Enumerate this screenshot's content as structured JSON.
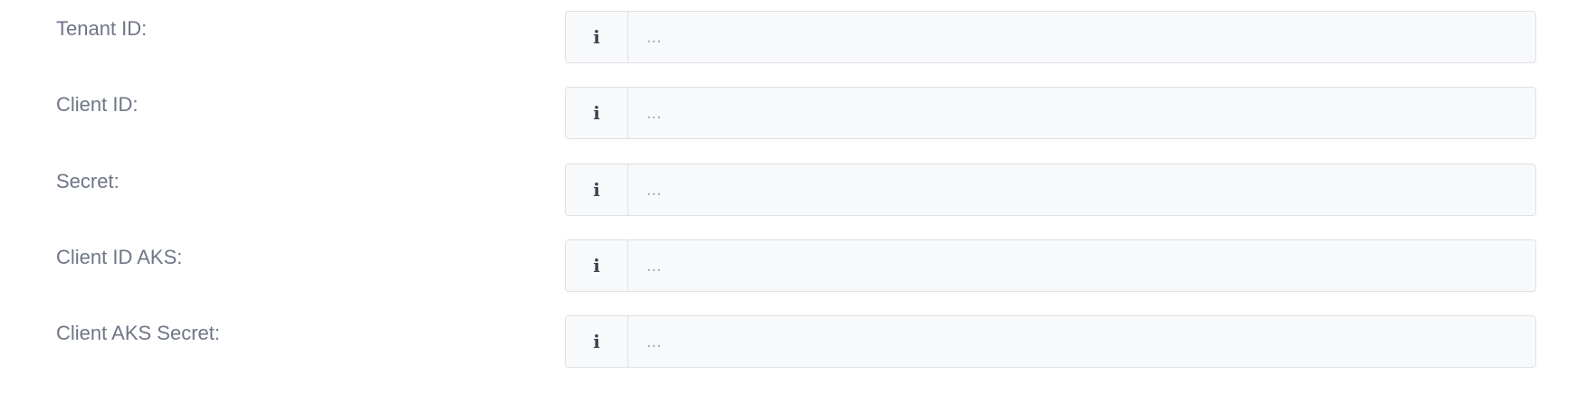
{
  "form": {
    "fields": [
      {
        "label": "Tenant ID:",
        "value": "",
        "placeholder": "...",
        "icon": "info-icon",
        "icon_glyph": "i"
      },
      {
        "label": "Client ID:",
        "value": "",
        "placeholder": "...",
        "icon": "info-icon",
        "icon_glyph": "i"
      },
      {
        "label": "Secret:",
        "value": "",
        "placeholder": "...",
        "icon": "info-icon",
        "icon_glyph": "i"
      },
      {
        "label": "Client ID AKS:",
        "value": "",
        "placeholder": "...",
        "icon": "info-icon",
        "icon_glyph": "i"
      },
      {
        "label": "Client AKS Secret:",
        "value": "",
        "placeholder": "...",
        "icon": "info-icon",
        "icon_glyph": "i"
      }
    ]
  },
  "colors": {
    "label_text": "#6e7687",
    "input_border": "#dfe1e5",
    "input_background": "#f8f9fb",
    "placeholder_text": "#a7acb6",
    "icon_color": "#3d4250"
  }
}
